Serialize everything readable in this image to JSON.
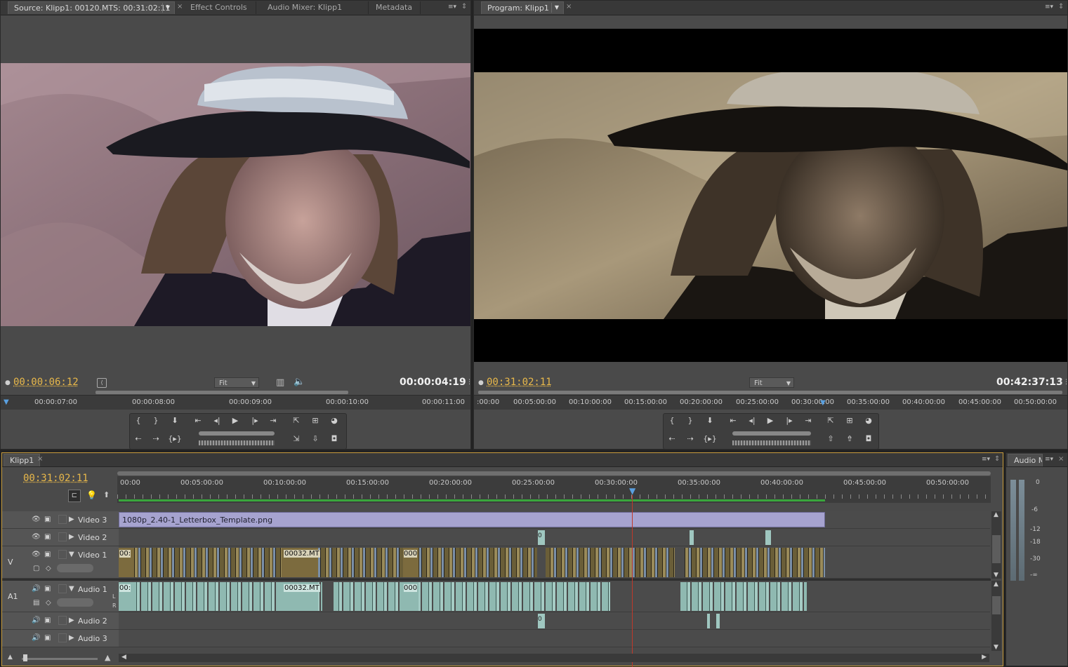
{
  "source": {
    "tabs": [
      {
        "label": "Source: Klipp1: 00120.MTS: 00:31:02:11"
      },
      {
        "label": "Effect Controls"
      },
      {
        "label": "Audio Mixer: Klipp1"
      },
      {
        "label": "Metadata"
      }
    ],
    "timecode_current": "00:00:06:12",
    "timecode_duration": "00:00:04:19",
    "fit": "Fit",
    "ruler": [
      "00:00:07:00",
      "00:00:08:00",
      "00:00:09:00",
      "00:00:10:00",
      "00:00:11:00"
    ]
  },
  "program": {
    "tab": "Program: Klipp1",
    "timecode_current": "00:31:02:11",
    "timecode_duration": "00:42:37:13",
    "fit": "Fit",
    "ruler": [
      ":00:00",
      "00:05:00:00",
      "00:10:00:00",
      "00:15:00:00",
      "00:20:00:00",
      "00:25:00:00",
      "00:30:00:00",
      "00:35:00:00",
      "00:40:00:00",
      "00:45:00:00",
      "00:50:00:00"
    ]
  },
  "timeline": {
    "tab": "Klipp1",
    "timecode": "00:31:02:11",
    "ruler": [
      "00:00",
      "00:05:00:00",
      "00:10:00:00",
      "00:15:00:00",
      "00:20:00:00",
      "00:25:00:00",
      "00:30:00:00",
      "00:35:00:00",
      "00:40:00:00",
      "00:45:00:00",
      "00:50:00:00"
    ],
    "tracks": {
      "video3": "Video 3",
      "video2": "Video 2",
      "video1": "Video 1",
      "audio1": "Audio 1",
      "audio2": "Audio 2",
      "audio3": "Audio 3"
    },
    "target_v": "V",
    "target_a": "A1",
    "v3_clip": "1080p_2.40-1_Letterbox_Template.png",
    "v1_clip": "00032.MT",
    "a1_clip": "00032.MT",
    "small_clip": "0",
    "clip_000": "000",
    "clip_00": "00:",
    "lr_l": "L",
    "lr_r": "R"
  },
  "audio_meter": {
    "tab": "Audio M",
    "scale": [
      "0",
      "-6",
      "-12",
      "-18",
      "-30",
      "-∞"
    ]
  },
  "colors": {
    "accent_timecode": "#e8b84a",
    "playhead": "#c0392b",
    "v3_clip": "#a6a3cf",
    "audio_clip": "#8fb9b1"
  }
}
